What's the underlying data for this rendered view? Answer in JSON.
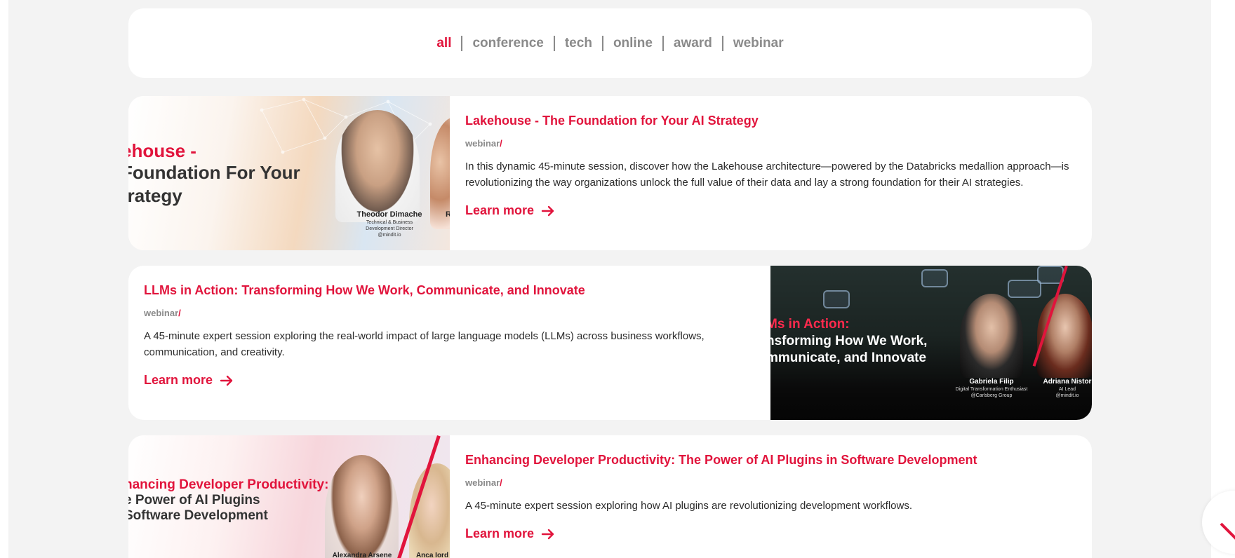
{
  "filters": [
    {
      "label": "all",
      "active": true
    },
    {
      "label": "conference",
      "active": false
    },
    {
      "label": "tech",
      "active": false
    },
    {
      "label": "online",
      "active": false
    },
    {
      "label": "award",
      "active": false
    },
    {
      "label": "webinar",
      "active": false
    }
  ],
  "cards": [
    {
      "title": "Lakehouse - The Foundation for Your AI Strategy",
      "tag": "webinar",
      "tag_sep": "/",
      "description": "In this dynamic 45-minute session, discover how the Lakehouse architecture—powered by the Databricks medallion approach—is revolutionizing the way organizations unlock the full value of their data and lay a strong foundation for their AI strategies.",
      "cta": "Learn more",
      "image": {
        "heading_red": "ehouse -",
        "heading_line2": "Foundation For Your",
        "heading_line3": "trategy",
        "speaker1_name": "Theodor Dimache",
        "speaker1_role1": "Technical & Business",
        "speaker1_role2": "Development Director",
        "speaker1_org": "@mindit.io",
        "speaker2_initial": "R"
      }
    },
    {
      "title": "LLMs in Action: Transforming How We Work, Communicate, and Innovate",
      "tag": "webinar",
      "tag_sep": "/",
      "description": "A 45-minute expert session exploring the real-world impact of large language models (LLMs) across business workflows, communication, and creativity.",
      "cta": "Learn more",
      "image": {
        "heading_red": "Ms in Action:",
        "heading_line2": "nsforming How We Work,",
        "heading_line3": "mmunicate, and Innovate",
        "speaker1_name": "Gabriela Filip",
        "speaker1_role1": "Digital Transformation Enthusiast",
        "speaker1_org": "@Carlsberg Group",
        "speaker2_name": "Adriana Nistor",
        "speaker2_role1": "AI Lead",
        "speaker2_org": "@mindit.io"
      }
    },
    {
      "title": "Enhancing Developer Productivity: The Power of AI Plugins in Software Development",
      "tag": "webinar",
      "tag_sep": "/",
      "description": "A 45-minute expert session exploring how AI plugins are revolutionizing development workflows.",
      "cta": "Learn more",
      "image": {
        "heading_red": "nancing Developer Productivity:",
        "heading_line2": "e Power of AI Plugins",
        "heading_line3": "Software Development",
        "speaker1_name": "Alexandra Arsene",
        "speaker2_name": "Anca Iord"
      }
    }
  ],
  "colors": {
    "accent": "#e1143c",
    "muted": "#8a8a8a",
    "background": "#f3f3f3"
  }
}
